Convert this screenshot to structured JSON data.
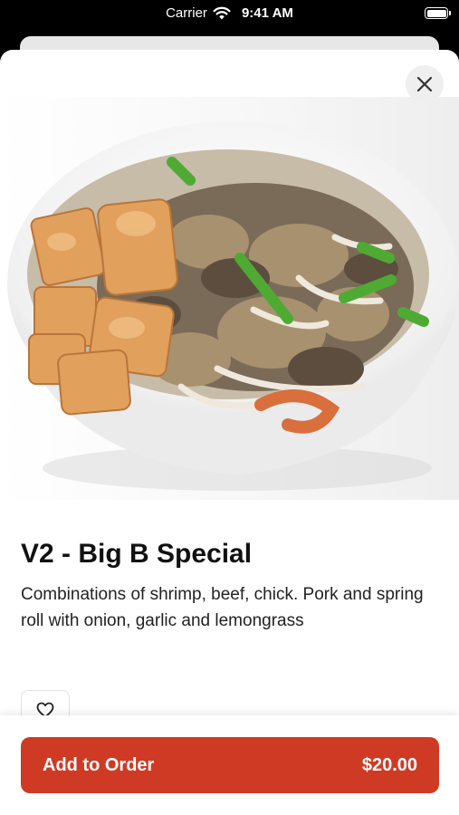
{
  "status_bar": {
    "carrier": "Carrier",
    "time": "9:41 AM"
  },
  "item": {
    "title": "V2 - Big B Special",
    "description": "Combinations of shrimp, beef, chick. Pork and spring roll with onion, garlic and lemongrass"
  },
  "order_button": {
    "label": "Add to Order",
    "price": "$20.00"
  },
  "colors": {
    "accent": "#cf3a24",
    "status_bar_bg": "#000000",
    "sheet_bg": "#ffffff"
  },
  "icons": {
    "close": "close-icon",
    "favorite": "heart-icon",
    "wifi": "wifi-icon",
    "battery": "battery-icon"
  }
}
